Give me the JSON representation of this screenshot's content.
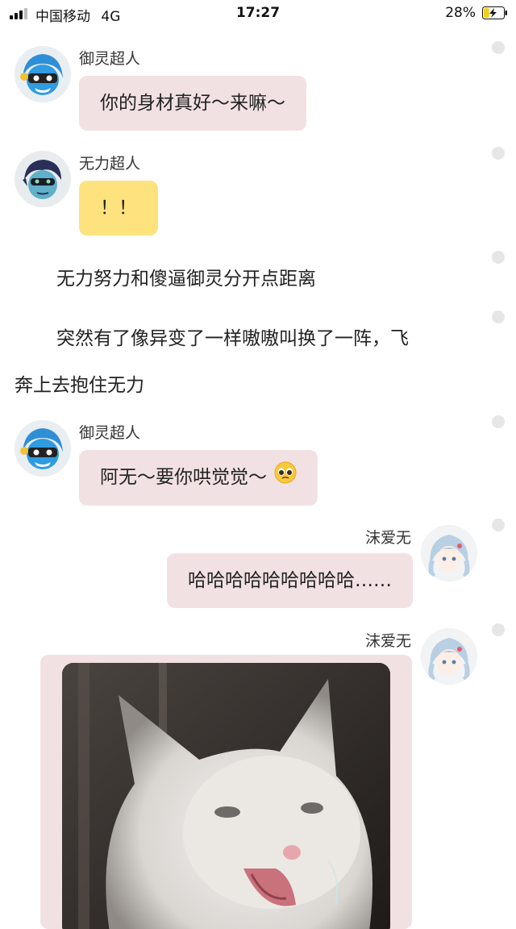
{
  "status_bar": {
    "carrier": "中国移动",
    "network": "4G",
    "time": "17:27",
    "battery_percent": "28%",
    "battery_level": 0.28,
    "icons": [
      "signal-icon",
      "battery-charging-icon"
    ]
  },
  "messages": [
    {
      "sender": "御灵超人",
      "text": "你的身材真好～来嘛～",
      "bubble_color": "#f2e1e3",
      "side": "left"
    },
    {
      "sender": "无力超人",
      "text": "！！",
      "bubble_color": "#fde27e",
      "side": "left"
    },
    {
      "sender": "御灵超人",
      "text": "阿无～要你哄觉觉～",
      "emoji": "🥺",
      "bubble_color": "#f2e1e3",
      "side": "left"
    },
    {
      "sender": "沫爱无",
      "text": "哈哈哈哈哈哈哈哈哈……",
      "bubble_color": "#f2e1e3",
      "side": "right"
    },
    {
      "sender": "沫爱无",
      "image": "crying-white-cat-photo",
      "bubble_color": "#f2e1e3",
      "side": "right"
    }
  ],
  "narration": [
    {
      "text": "无力努力和傻逼御灵分开点距离"
    },
    {
      "line1": "突然有了像异变了一样嗷嗷叫换了一阵，飞",
      "line2": "奔上去抱住无力"
    }
  ]
}
